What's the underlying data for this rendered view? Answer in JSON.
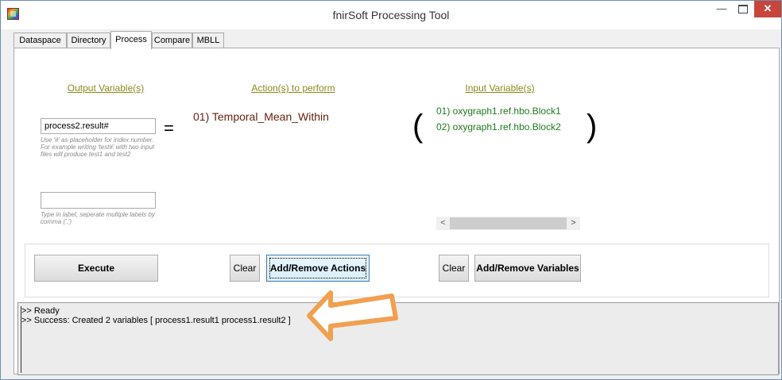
{
  "window": {
    "title": "fnirSoft Processing Tool",
    "minimize_glyph": "—",
    "close_glyph": "✕"
  },
  "tabs": [
    {
      "label": "Dataspace",
      "active": false
    },
    {
      "label": "Directory",
      "active": false
    },
    {
      "label": "Process",
      "active": true
    },
    {
      "label": "Compare",
      "active": false
    },
    {
      "label": "MBLL",
      "active": false
    }
  ],
  "output": {
    "heading": "Output Variable(s)",
    "variable_value": "process2.result#",
    "variable_hint": "Use '#' as placeholder for index number. For example writing 'test#' with two input files will produce test1 and test2",
    "label_value": "",
    "label_hint": "Type in label, seperate multiple labels by comma (',')",
    "equals": "="
  },
  "actions": {
    "heading": "Action(s) to perform",
    "items": [
      "01) Temporal_Mean_Within"
    ]
  },
  "inputs": {
    "heading": "Input Variable(s)",
    "open_paren": "(",
    "close_paren": ")",
    "items": [
      "01) oxygraph1.ref.hbo.Block1",
      "02) oxygraph1.ref.hbo.Block2"
    ],
    "scroll_left": "<",
    "scroll_right": ">"
  },
  "buttons": {
    "execute": "Execute",
    "clear_actions": "Clear",
    "add_remove_actions": "Add/Remove Actions",
    "clear_variables": "Clear",
    "add_remove_variables": "Add/Remove Variables"
  },
  "console": {
    "lines": [
      ">> Ready",
      ">> Success: Created 2 variables [ process1.result1 process1.result2 ]"
    ]
  },
  "colors": {
    "heading": "#8a8a1a",
    "action_text": "#6a2010",
    "input_text": "#1e7a1e",
    "annotation_arrow": "#f0a050",
    "close_button": "#c7453a"
  },
  "icons": {
    "app": "app-icon",
    "annotation": "arrow-left-icon"
  }
}
